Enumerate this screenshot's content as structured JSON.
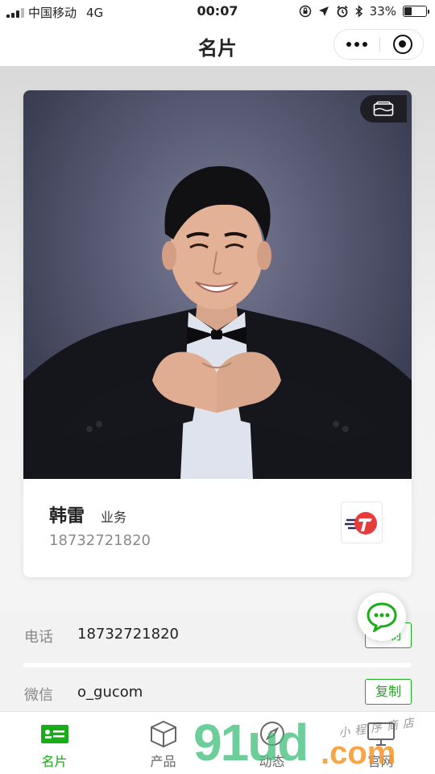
{
  "status_bar": {
    "carrier": "中国移动",
    "network": "4G",
    "time": "00:07",
    "battery": "33%"
  },
  "nav": {
    "title": "名片"
  },
  "card": {
    "name": "韩雷",
    "role": "业务",
    "phone": "18732721820"
  },
  "info": {
    "phone_label": "电话",
    "phone_value": "18732721820",
    "wechat_label": "微信",
    "wechat_value": "o_gucom",
    "copy_label": "复制"
  },
  "tabs": [
    {
      "label": "名片",
      "icon": "card-icon",
      "active": true
    },
    {
      "label": "产品",
      "icon": "box-icon",
      "active": false
    },
    {
      "label": "动态",
      "icon": "compass-icon",
      "active": false
    },
    {
      "label": "官网",
      "icon": "monitor-icon",
      "active": false
    }
  ],
  "watermark": {
    "number": "91ud",
    "domain": ".com",
    "tagline": "小程序商店"
  },
  "colors": {
    "accent": "#1aad19",
    "background": "#f2f2f2"
  }
}
